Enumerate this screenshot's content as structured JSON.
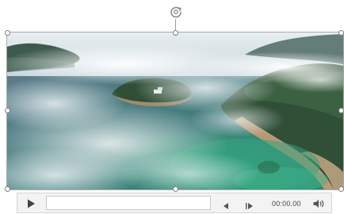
{
  "player": {
    "time": "00:00.00",
    "progress": 0
  },
  "icons": {
    "rotate": "rotate-icon",
    "play": "play-icon",
    "step_back": "step-back-icon",
    "step_forward": "step-forward-icon",
    "volume": "volume-icon"
  },
  "colors": {
    "control_bar": "#f3f3f3",
    "frame": "#a8a8a8",
    "icon": "#444444"
  }
}
